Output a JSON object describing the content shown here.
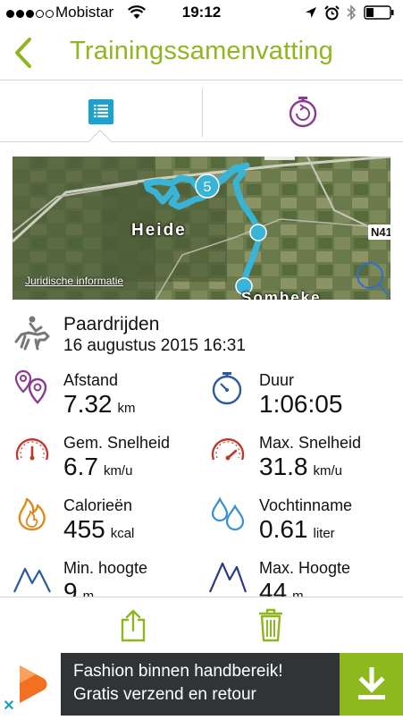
{
  "status_bar": {
    "carrier": "Mobistar",
    "time": "19:12",
    "signal_dots": 3,
    "icons": [
      "signal-dots-icon",
      "wifi-icon",
      "location-arrow-icon",
      "alarm-icon",
      "bluetooth-icon",
      "battery-icon"
    ]
  },
  "nav": {
    "title": "Trainingssamenvatting",
    "back_icon": "chevron-left-icon"
  },
  "tabs": [
    {
      "name": "summary",
      "icon": "list-icon",
      "selected": true
    },
    {
      "name": "laps",
      "icon": "stopwatch-icon",
      "selected": false
    }
  ],
  "map": {
    "place_heide": "Heide",
    "place_zombeke": "Sombeke",
    "road_badge": "N41",
    "legal_link": "Juridische informatie",
    "lap_marker": "5"
  },
  "activity": {
    "name": "Paardrijden",
    "datetime": "16 augustus 2015 16:31",
    "icon": "horse-rider-icon"
  },
  "stats": [
    {
      "key": "distance",
      "label": "Afstand",
      "value": "7.32",
      "unit": "km",
      "icon": "map-pins-icon"
    },
    {
      "key": "duration",
      "label": "Duur",
      "value": "1:06:05",
      "unit": "",
      "icon": "stopwatch-icon"
    },
    {
      "key": "avg_speed",
      "label": "Gem. Snelheid",
      "value": "6.7",
      "unit": "km/u",
      "icon": "speedometer-icon"
    },
    {
      "key": "max_speed",
      "label": "Max. Snelheid",
      "value": "31.8",
      "unit": "km/u",
      "icon": "speedometer-icon"
    },
    {
      "key": "calories",
      "label": "Calorieën",
      "value": "455",
      "unit": "kcal",
      "icon": "flame-icon"
    },
    {
      "key": "hydration",
      "label": "Vochtinname",
      "value": "0.61",
      "unit": "liter",
      "icon": "water-drops-icon"
    },
    {
      "key": "min_altitude",
      "label": "Min. hoogte",
      "value": "9",
      "unit": "m",
      "icon": "mountains-icon"
    },
    {
      "key": "max_altitude",
      "label": "Max. Hoogte",
      "value": "44",
      "unit": "m",
      "icon": "mountains-icon"
    }
  ],
  "toolbar": {
    "share_icon": "share-icon",
    "trash_icon": "trash-icon"
  },
  "ad": {
    "line1": "Fashion binnen handbereik!",
    "line2": "Gratis verzend en retour",
    "close_label": "✕",
    "cta_icon": "download-arrow-icon"
  },
  "colors": {
    "brand_green": "#8fb620",
    "map_route": "#3ab4d6",
    "purple": "#8a3b8f",
    "blue": "#2c5aa0",
    "red": "#c0392b",
    "orange": "#e08a1e"
  }
}
